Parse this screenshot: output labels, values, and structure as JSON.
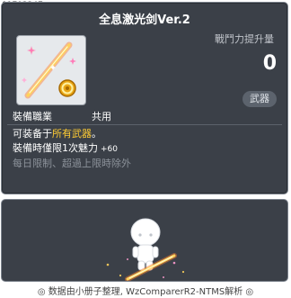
{
  "item_id": "01703247",
  "title": "全息激光剑Ver.2",
  "power": {
    "label": "戰鬥力提升量",
    "value": "0"
  },
  "category_badge": "武器",
  "job": {
    "label": "裝備職業",
    "value": "共用"
  },
  "description": {
    "line1_prefix": "可装备于",
    "line1_highlight": "所有武器",
    "line1_suffix": "。",
    "line2_text": "裝備時僅限1次魅力",
    "line2_bonus": "+60",
    "line3": "每日限制、超過上限時除外"
  },
  "footer": "◎ 数据由小册子整理, WzComparerR2-NTMS解析 ◎",
  "colors": {
    "accent": "#ffcc33",
    "panel": "#3b4048",
    "muted": "#8c929a"
  }
}
